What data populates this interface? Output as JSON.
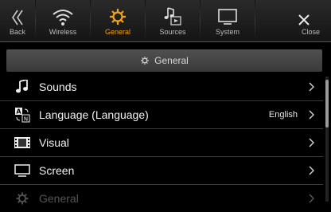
{
  "tabs": [
    {
      "key": "back",
      "label": "Back",
      "icon": "double-chevron-left-icon"
    },
    {
      "key": "wireless",
      "label": "Wireless",
      "icon": "wifi-icon"
    },
    {
      "key": "general",
      "label": "General",
      "icon": "gear-icon",
      "active": true
    },
    {
      "key": "sources",
      "label": "Sources",
      "icon": "music-source-icon"
    },
    {
      "key": "system",
      "label": "System",
      "icon": "monitor-icon"
    },
    {
      "key": "close",
      "label": "Close",
      "icon": "close-icon"
    }
  ],
  "section": {
    "title": "General",
    "icon": "gear-icon"
  },
  "items": [
    {
      "label": "Sounds",
      "value": "",
      "icon": "music-note-icon"
    },
    {
      "label": "Language (Language)",
      "value": "English",
      "icon": "language-icon"
    },
    {
      "label": "Visual",
      "value": "",
      "icon": "film-icon"
    },
    {
      "label": "Screen",
      "value": "",
      "icon": "screen-icon"
    },
    {
      "label": "General",
      "value": "",
      "icon": "gear-icon"
    }
  ],
  "colors": {
    "accent": "#f3a21b",
    "background": "#000000",
    "header": "#444444"
  }
}
